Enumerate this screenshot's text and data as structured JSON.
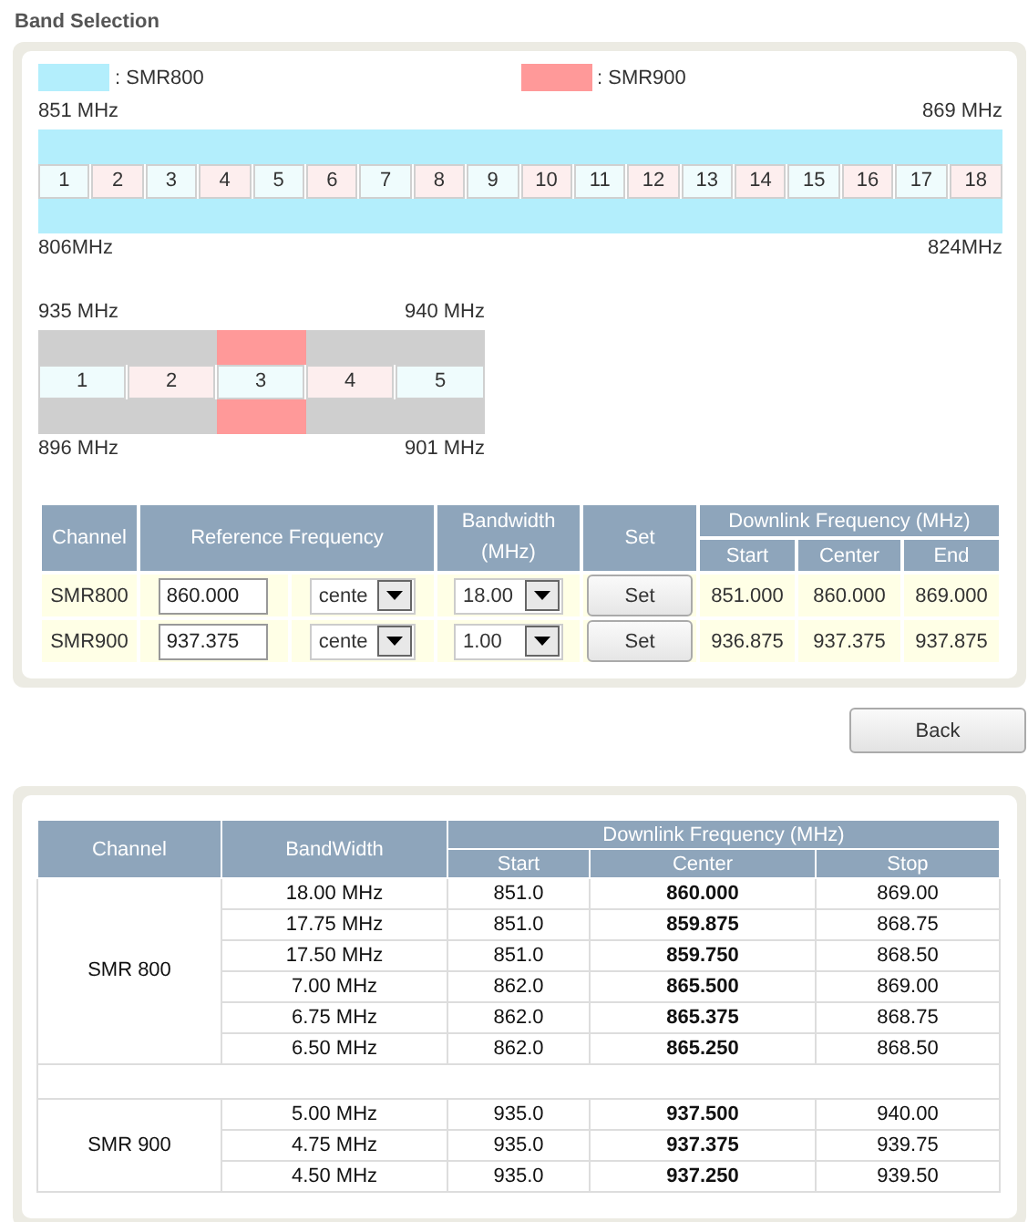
{
  "title": "Band Selection",
  "legend": [
    {
      "label": ": SMR800",
      "color": "#b3eefc"
    },
    {
      "label": ": SMR900",
      "color": "#ff9999"
    }
  ],
  "bands": [
    {
      "top_left": "851 MHz",
      "top_right": "869 MHz",
      "bottom_left": "806MHz",
      "bottom_right": "824MHz",
      "color": "#b3eefc",
      "cells": [
        {
          "label": "1",
          "selected": true
        },
        {
          "label": "2",
          "selected": true
        },
        {
          "label": "3",
          "selected": true
        },
        {
          "label": "4",
          "selected": true
        },
        {
          "label": "5",
          "selected": true
        },
        {
          "label": "6",
          "selected": true
        },
        {
          "label": "7",
          "selected": true
        },
        {
          "label": "8",
          "selected": true
        },
        {
          "label": "9",
          "selected": true
        },
        {
          "label": "10",
          "selected": true
        },
        {
          "label": "11",
          "selected": true
        },
        {
          "label": "12",
          "selected": true
        },
        {
          "label": "13",
          "selected": true
        },
        {
          "label": "14",
          "selected": true
        },
        {
          "label": "15",
          "selected": true
        },
        {
          "label": "16",
          "selected": true
        },
        {
          "label": "17",
          "selected": true
        },
        {
          "label": "18",
          "selected": true
        }
      ]
    },
    {
      "top_left": "935 MHz",
      "top_right": "940 MHz",
      "bottom_left": "896 MHz",
      "bottom_right": "901 MHz",
      "color": "#ff9999",
      "cells": [
        {
          "label": "1",
          "selected": false
        },
        {
          "label": "2",
          "selected": false
        },
        {
          "label": "3",
          "selected": true
        },
        {
          "label": "4",
          "selected": false
        },
        {
          "label": "5",
          "selected": false
        }
      ]
    }
  ],
  "settings": {
    "headers": {
      "channel": "Channel",
      "reference": "Reference Frequency",
      "bandwidth": "Bandwidth (MHz)",
      "set": "Set",
      "downlink": "Downlink Frequency (MHz)",
      "start": "Start",
      "center": "Center",
      "end": "End"
    },
    "rows": [
      {
        "channel": "SMR800",
        "reference": "860.000",
        "mode": "cente",
        "bandwidth": "18.00",
        "button": "Set",
        "start": "851.000",
        "center": "860.000",
        "end": "869.000"
      },
      {
        "channel": "SMR900",
        "reference": "937.375",
        "mode": "cente",
        "bandwidth": "1.00",
        "button": "Set",
        "start": "936.875",
        "center": "937.375",
        "end": "937.875"
      }
    ]
  },
  "back_button": "Back",
  "summary": {
    "headers": {
      "channel": "Channel",
      "bandwidth": "BandWidth",
      "downlink": "Downlink Frequency (MHz)",
      "start": "Start",
      "center": "Center",
      "stop": "Stop"
    },
    "groups": [
      {
        "channel": "SMR 800",
        "rows": [
          {
            "bandwidth": "18.00 MHz",
            "start": "851.0",
            "center": "860.000",
            "stop": "869.00"
          },
          {
            "bandwidth": "17.75 MHz",
            "start": "851.0",
            "center": "859.875",
            "stop": "868.75"
          },
          {
            "bandwidth": "17.50 MHz",
            "start": "851.0",
            "center": "859.750",
            "stop": "868.50"
          },
          {
            "bandwidth": "7.00 MHz",
            "start": "862.0",
            "center": "865.500",
            "stop": "869.00"
          },
          {
            "bandwidth": "6.75 MHz",
            "start": "862.0",
            "center": "865.375",
            "stop": "868.75"
          },
          {
            "bandwidth": "6.50 MHz",
            "start": "862.0",
            "center": "865.250",
            "stop": "868.50"
          }
        ]
      },
      {
        "channel": "SMR 900",
        "rows": [
          {
            "bandwidth": "5.00 MHz",
            "start": "935.0",
            "center": "937.500",
            "stop": "940.00"
          },
          {
            "bandwidth": "4.75 MHz",
            "start": "935.0",
            "center": "937.375",
            "stop": "939.75"
          },
          {
            "bandwidth": "4.50 MHz",
            "start": "935.0",
            "center": "937.250",
            "stop": "939.50"
          }
        ]
      }
    ]
  }
}
